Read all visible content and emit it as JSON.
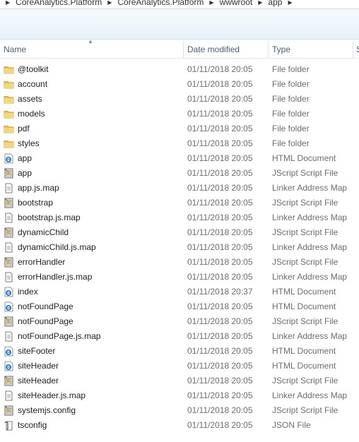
{
  "breadcrumb": {
    "items": [
      "CoreAnalytics.Platform",
      "CoreAnalytics.Platform",
      "wwwroot",
      "app"
    ]
  },
  "columns": {
    "name": "Name",
    "date_modified": "Date modified",
    "type": "Type",
    "size": "S"
  },
  "colors": {
    "folder": "#e8c25a",
    "header_text": "#4c607a",
    "secondary_text": "#6d6d6d"
  },
  "files": [
    {
      "name": "@toolkit",
      "date": "01/11/2018 20:05",
      "type": "File folder",
      "icon": "folder-icon"
    },
    {
      "name": "account",
      "date": "01/11/2018 20:05",
      "type": "File folder",
      "icon": "folder-icon"
    },
    {
      "name": "assets",
      "date": "01/11/2018 20:05",
      "type": "File folder",
      "icon": "folder-icon"
    },
    {
      "name": "models",
      "date": "01/11/2018 20:05",
      "type": "File folder",
      "icon": "folder-icon"
    },
    {
      "name": "pdf",
      "date": "01/11/2018 20:05",
      "type": "File folder",
      "icon": "folder-icon"
    },
    {
      "name": "styles",
      "date": "01/11/2018 20:05",
      "type": "File folder",
      "icon": "folder-icon"
    },
    {
      "name": "app",
      "date": "01/11/2018 20:05",
      "type": "HTML Document",
      "icon": "html-document-icon"
    },
    {
      "name": "app",
      "date": "01/11/2018 20:05",
      "type": "JScript Script File",
      "icon": "script-file-icon"
    },
    {
      "name": "app.js.map",
      "date": "01/11/2018 20:05",
      "type": "Linker Address Map",
      "icon": "map-file-icon"
    },
    {
      "name": "bootstrap",
      "date": "01/11/2018 20:05",
      "type": "JScript Script File",
      "icon": "script-file-icon"
    },
    {
      "name": "bootstrap.js.map",
      "date": "01/11/2018 20:05",
      "type": "Linker Address Map",
      "icon": "map-file-icon"
    },
    {
      "name": "dynamicChild",
      "date": "01/11/2018 20:05",
      "type": "JScript Script File",
      "icon": "script-file-icon"
    },
    {
      "name": "dynamicChild.js.map",
      "date": "01/11/2018 20:05",
      "type": "Linker Address Map",
      "icon": "map-file-icon"
    },
    {
      "name": "errorHandler",
      "date": "01/11/2018 20:05",
      "type": "JScript Script File",
      "icon": "script-file-icon"
    },
    {
      "name": "errorHandler.js.map",
      "date": "01/11/2018 20:05",
      "type": "Linker Address Map",
      "icon": "map-file-icon"
    },
    {
      "name": "index",
      "date": "01/11/2018 20:37",
      "type": "HTML Document",
      "icon": "html-document-icon"
    },
    {
      "name": "notFoundPage",
      "date": "01/11/2018 20:05",
      "type": "HTML Document",
      "icon": "html-document-icon"
    },
    {
      "name": "notFoundPage",
      "date": "01/11/2018 20:05",
      "type": "JScript Script File",
      "icon": "script-file-icon"
    },
    {
      "name": "notFoundPage.js.map",
      "date": "01/11/2018 20:05",
      "type": "Linker Address Map",
      "icon": "map-file-icon"
    },
    {
      "name": "siteFooter",
      "date": "01/11/2018 20:05",
      "type": "HTML Document",
      "icon": "html-document-icon"
    },
    {
      "name": "siteHeader",
      "date": "01/11/2018 20:05",
      "type": "HTML Document",
      "icon": "html-document-icon"
    },
    {
      "name": "siteHeader",
      "date": "01/11/2018 20:05",
      "type": "JScript Script File",
      "icon": "script-file-icon"
    },
    {
      "name": "siteHeader.js.map",
      "date": "01/11/2018 20:05",
      "type": "Linker Address Map",
      "icon": "map-file-icon"
    },
    {
      "name": "systemjs.config",
      "date": "01/11/2018 20:05",
      "type": "JScript Script File",
      "icon": "script-file-icon"
    },
    {
      "name": "tsconfig",
      "date": "01/11/2018 20:05",
      "type": "JSON File",
      "icon": "json-file-icon"
    }
  ]
}
